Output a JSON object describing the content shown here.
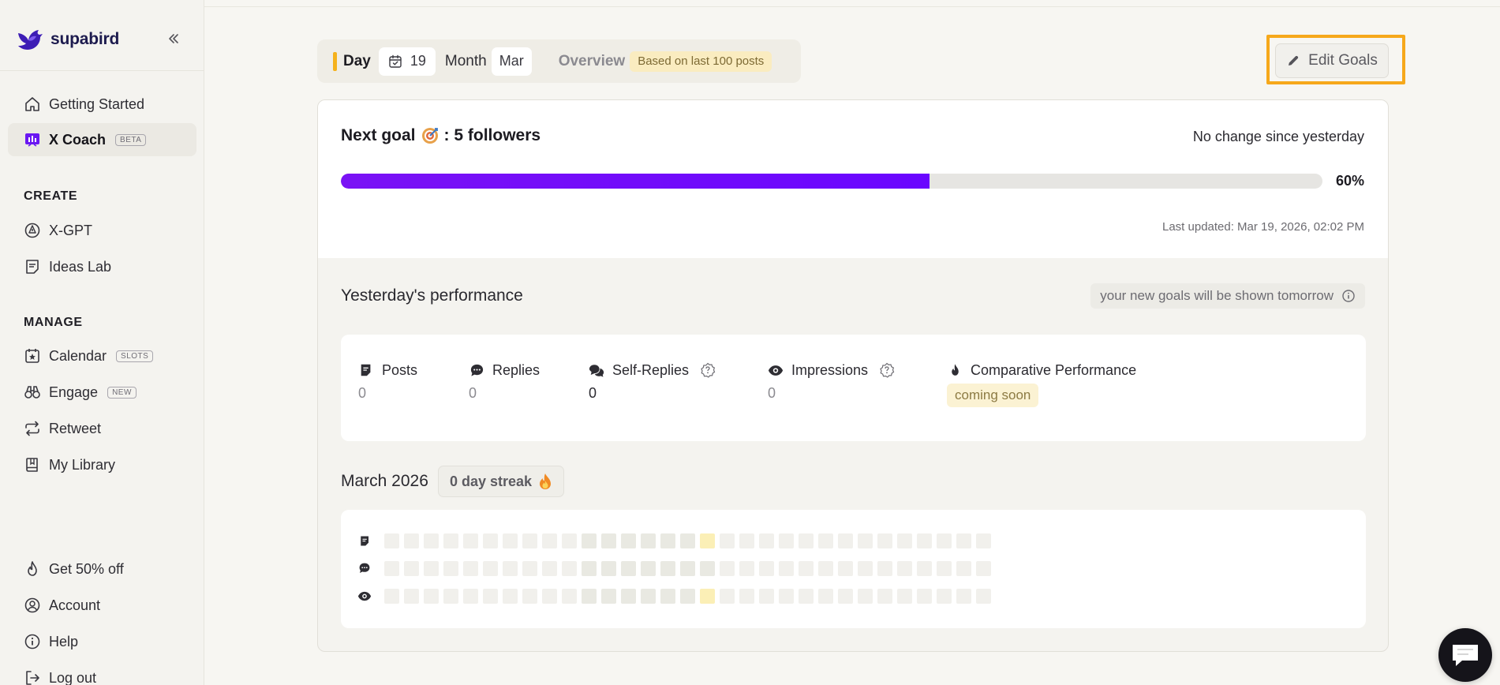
{
  "brand": {
    "name": "supabird"
  },
  "sidebar": {
    "top_items": [
      {
        "label": "Getting Started"
      },
      {
        "label": "X Coach",
        "tag": "BETA"
      }
    ],
    "create_title": "CREATE",
    "create_items": [
      {
        "label": "X-GPT"
      },
      {
        "label": "Ideas Lab"
      }
    ],
    "manage_title": "MANAGE",
    "manage_items": [
      {
        "label": "Calendar",
        "tag": "SLOTS"
      },
      {
        "label": "Engage",
        "tag": "NEW"
      },
      {
        "label": "Retweet"
      },
      {
        "label": "My Library"
      }
    ],
    "bottom_items": [
      {
        "label": "Get 50% off"
      },
      {
        "label": "Account"
      },
      {
        "label": "Help"
      },
      {
        "label": "Log out"
      }
    ]
  },
  "filter": {
    "day_label": "Day",
    "date_value": "19",
    "month_label": "Month",
    "month_value": "Mar",
    "overview_label": "Overview",
    "based_on": "Based on last 100 posts"
  },
  "edit_goals_label": "Edit Goals",
  "goal": {
    "prefix": "Next goal",
    "suffix": ": 5 followers",
    "change_text": "No change since yesterday",
    "progress": 0.6,
    "progress_label": "60%",
    "last_updated": "Last updated: Mar 19, 2026, 02:02 PM"
  },
  "performance": {
    "title": "Yesterday's performance",
    "note": "your new goals will be shown tomorrow",
    "stats": [
      {
        "label": "Posts",
        "value": "0"
      },
      {
        "label": "Replies",
        "value": "0"
      },
      {
        "label": "Self-Replies",
        "value": "0"
      },
      {
        "label": "Impressions",
        "value": "0"
      },
      {
        "label": "Comparative Performance",
        "value": "coming soon"
      }
    ]
  },
  "calendar": {
    "title": "March 2026",
    "streak": "0 day streak",
    "days": 31,
    "today_index": 16
  },
  "colors": {
    "accent_purple": "#7a12f5",
    "highlight_orange": "#f6a81b",
    "today_cell": "#fbefb6"
  }
}
